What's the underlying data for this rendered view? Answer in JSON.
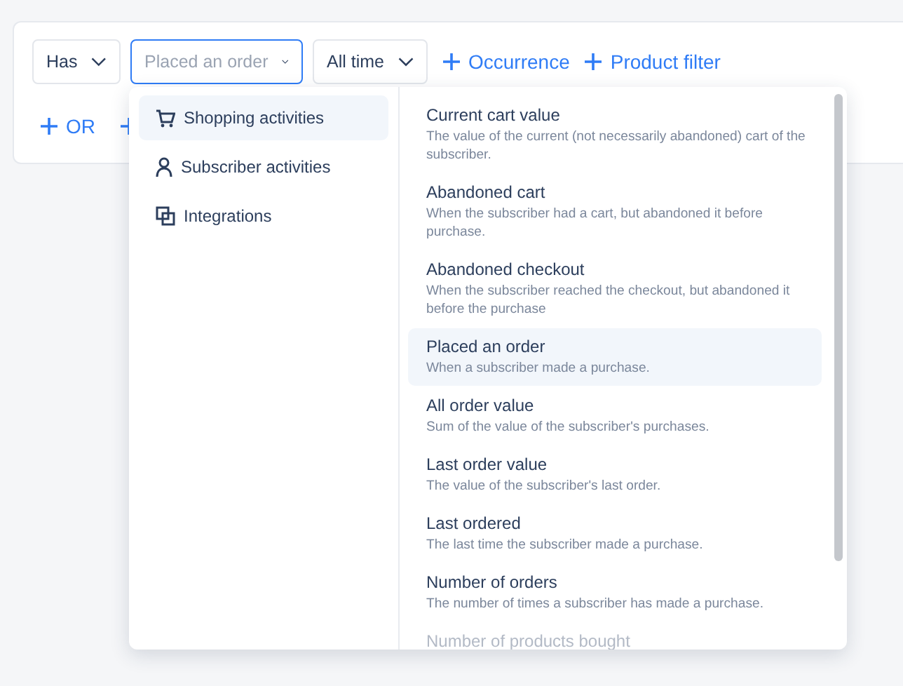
{
  "filters": [
    {
      "kind": "select",
      "value": "Has"
    },
    {
      "kind": "select",
      "placeholder": "Placed an order",
      "focused": true
    },
    {
      "kind": "select",
      "value": "All time"
    },
    {
      "kind": "add",
      "label": "Occurrence"
    },
    {
      "kind": "add",
      "label": "Product filter"
    }
  ],
  "group_actions": [
    {
      "kind": "labeled",
      "label": "OR"
    },
    {
      "kind": "bare"
    }
  ],
  "categories": [
    {
      "label": "Shopping activities",
      "kind": "cart",
      "selected": true
    },
    {
      "label": "Subscriber activities",
      "kind": "person",
      "selected": false
    },
    {
      "label": "Integrations",
      "kind": "squares",
      "selected": false
    }
  ],
  "events": [
    {
      "title": "Current cart value",
      "description": "The value of the current (not necessarily abandoned) cart of the subscriber.",
      "selected": false,
      "faded": false
    },
    {
      "title": "Abandoned cart",
      "description": "When the subscriber had a cart, but abandoned it before purchase.",
      "selected": false,
      "faded": false
    },
    {
      "title": "Abandoned checkout",
      "description": "When the subscriber reached the checkout, but abandoned it before the purchase",
      "selected": false,
      "faded": false
    },
    {
      "title": "Placed an order",
      "description": "When a subscriber made a purchase.",
      "selected": true,
      "faded": false
    },
    {
      "title": "All order value",
      "description": "Sum of the value of the subscriber's purchases.",
      "selected": false,
      "faded": false
    },
    {
      "title": "Last order value",
      "description": "The value of the subscriber's last order.",
      "selected": false,
      "faded": false
    },
    {
      "title": "Last ordered",
      "description": "The last time the subscriber made a purchase.",
      "selected": false,
      "faded": false
    },
    {
      "title": "Number of orders",
      "description": "The number of times a subscriber has made a purchase.",
      "selected": false,
      "faded": false
    },
    {
      "title": "Number of products bought",
      "selected": false,
      "faded": true
    }
  ]
}
